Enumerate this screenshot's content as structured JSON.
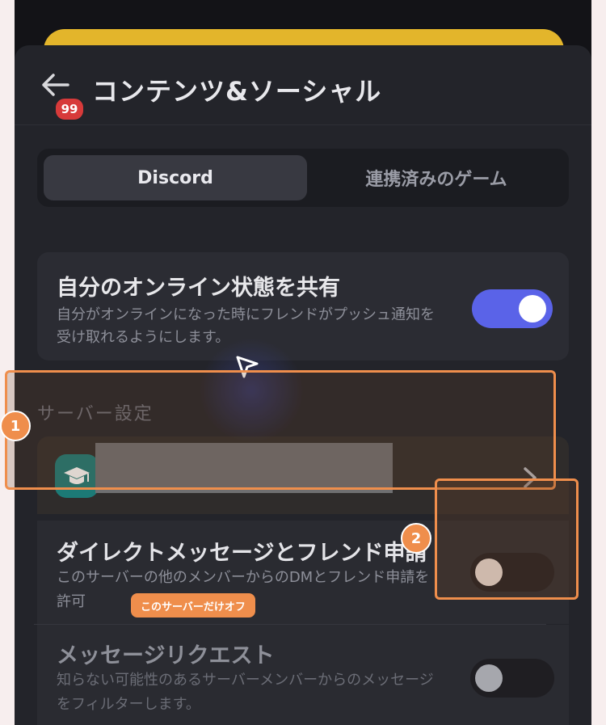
{
  "header": {
    "title": "コンテンツ&ソーシャル",
    "badge_count": "99"
  },
  "tabs": [
    {
      "label": "Discord",
      "active": true
    },
    {
      "label": "連携済みのゲーム",
      "active": false
    }
  ],
  "online_status": {
    "title": "自分のオンライン状態を共有",
    "description": "自分がオンラインになった時にフレンドがプッシュ通知を受け取れるようにします。",
    "enabled": true
  },
  "server_settings": {
    "section_label": "サーバー設定",
    "server_icon": "graduation-cap-icon"
  },
  "dm_requests": {
    "title": "ダイレクトメッセージとフレンド申請",
    "description": "このサーバーの他のメンバーからのDMとフレンド申請を許可",
    "enabled": false
  },
  "message_requests": {
    "title": "メッセージリクエスト",
    "description": "知らない可能性のあるサーバーメンバーからのメッセージをフィルターします。",
    "enabled": false
  },
  "annotations": {
    "marker_1": "1",
    "marker_2": "2",
    "tooltip": "このサーバーだけオフ"
  },
  "colors": {
    "accent_toggle": "#5a63e8",
    "highlight": "#ef8e4c",
    "banner": "#e3b52b"
  }
}
